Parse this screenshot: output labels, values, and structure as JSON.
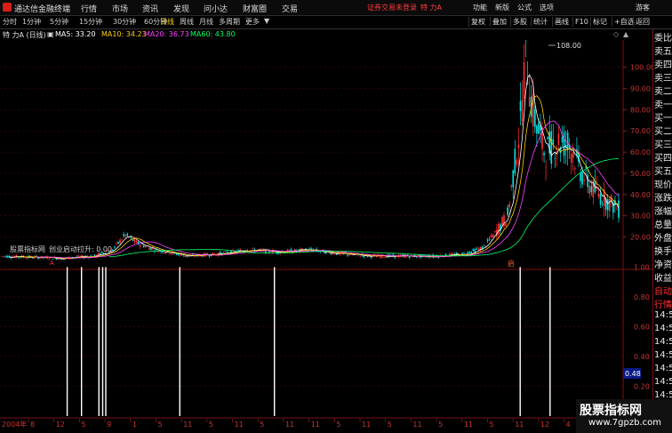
{
  "titlebar": {
    "app_name": "通达信金融终端",
    "menus": [
      "行情",
      "市场",
      "资讯",
      "发现",
      "问小达",
      "财富圈",
      "交易"
    ],
    "login_warning": "证券交易未登录",
    "stock_name": "特 力A",
    "right_menus": [
      "功能",
      "新版",
      "公式",
      "选项",
      "游客"
    ]
  },
  "toolbar": {
    "periods": [
      "分时",
      "1分钟",
      "5分钟",
      "15分钟",
      "30分钟",
      "60分钟",
      "日线",
      "周线",
      "月线",
      "多周期",
      "更多"
    ],
    "active_period": "日线",
    "buttons": [
      "复权",
      "叠加",
      "多股",
      "统计",
      "画线",
      "F10",
      "标记",
      "+自选",
      "返回"
    ]
  },
  "info": {
    "title": "特 力A (日线)",
    "ma5_label": "MA5: 33.20",
    "ma10_label": "MA10: 34.23",
    "ma20_label": "MA20: 36.73",
    "ma60_label": "MA60: 43.80",
    "colors": {
      "ma5": "#ffffff",
      "ma10": "#ffd000",
      "ma20": "#ff44ff",
      "ma60": "#00ff66"
    }
  },
  "indicator": {
    "label": "股票指标网",
    "name": "创业启动拉升: 0.00",
    "current_value": "0.48"
  },
  "chart_data": [
    {
      "type": "candlestick",
      "title": "特 力A (日线)",
      "peak_label": "108.00",
      "y_ticks": [
        20,
        30,
        40,
        50,
        60,
        70,
        80,
        90,
        100
      ],
      "ylim": [
        6,
        112
      ],
      "low_marker": "A",
      "signal_marker": "启",
      "close_path": [
        [
          0,
          11
        ],
        [
          0.05,
          10.5
        ],
        [
          0.1,
          10
        ],
        [
          0.15,
          11
        ],
        [
          0.18,
          14
        ],
        [
          0.2,
          21
        ],
        [
          0.22,
          17
        ],
        [
          0.25,
          14
        ],
        [
          0.3,
          11
        ],
        [
          0.35,
          12
        ],
        [
          0.4,
          14
        ],
        [
          0.45,
          13
        ],
        [
          0.5,
          14
        ],
        [
          0.55,
          12
        ],
        [
          0.6,
          11
        ],
        [
          0.65,
          11
        ],
        [
          0.7,
          11
        ],
        [
          0.75,
          12
        ],
        [
          0.78,
          15
        ],
        [
          0.8,
          22
        ],
        [
          0.82,
          30
        ],
        [
          0.84,
          72
        ],
        [
          0.85,
          108
        ],
        [
          0.86,
          80
        ],
        [
          0.88,
          60
        ],
        [
          0.9,
          65
        ],
        [
          0.92,
          64
        ],
        [
          0.94,
          50
        ],
        [
          0.96,
          42
        ],
        [
          1,
          33
        ]
      ]
    },
    {
      "type": "bar",
      "title": "创业启动拉升",
      "y_ticks": [
        0.2,
        0.4,
        0.6,
        0.8,
        1.0
      ],
      "ylim": [
        0,
        1.08
      ],
      "signal_x": [
        0.108,
        0.131,
        0.159,
        0.165,
        0.17,
        0.289,
        0.441,
        0.836,
        0.884
      ]
    }
  ],
  "x_axis_labels": [
    "2004年",
    "8",
    "12",
    "5",
    "9",
    "1",
    "5",
    "11",
    "5",
    "11",
    "5",
    "11",
    "11",
    "5",
    "11",
    "5",
    "11",
    "5",
    "11",
    "5",
    "11",
    "12",
    "4",
    "9"
  ],
  "side_panel": {
    "top_label": "L",
    "labels": [
      "委比",
      "卖五",
      "卖四",
      "卖三",
      "卖二",
      "卖一",
      "买一",
      "买二",
      "买三",
      "买四",
      "买五",
      "现价",
      "涨跌",
      "涨幅",
      "总量",
      "外盘",
      "换手",
      "净资",
      "收益",
      "自动",
      "行情",
      "14:5",
      "14:5",
      "14:5",
      "14:5",
      "14:5",
      "14:5",
      "14:5",
      "14:5",
      "14:5"
    ]
  },
  "watermark": {
    "line1": "股票指标网",
    "line2": "www.7gpzb.com"
  }
}
